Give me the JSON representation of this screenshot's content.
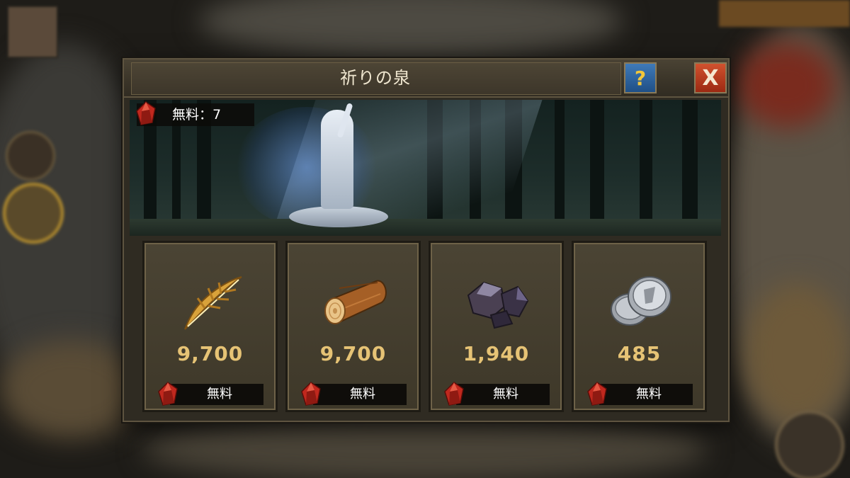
{
  "dialog": {
    "title": "祈りの泉",
    "help_label": "?",
    "close_label": "X"
  },
  "free_counter": {
    "text": "無料：7",
    "icon": "red-gem-icon"
  },
  "cards": [
    {
      "resource": "food",
      "icon": "golden-leaf-icon",
      "amount": "9,700",
      "cost_label": "無料"
    },
    {
      "resource": "wood",
      "icon": "log-icon",
      "amount": "9,700",
      "cost_label": "無料"
    },
    {
      "resource": "iron",
      "icon": "ore-icon",
      "amount": "1,940",
      "cost_label": "無料"
    },
    {
      "resource": "silver",
      "icon": "silver-coins-icon",
      "amount": "485",
      "cost_label": "無料"
    }
  ],
  "colors": {
    "amount_gold": "#e6c375",
    "help_blue": "#2f66a3",
    "close_red": "#b83c1e",
    "gem_red": "#c0281e"
  }
}
